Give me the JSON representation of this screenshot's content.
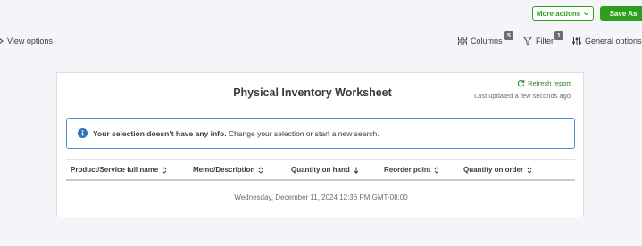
{
  "topbar": {
    "more_actions_label": "More actions",
    "save_as_label": "Save As"
  },
  "toolbar": {
    "view_options_label": "View options",
    "columns_label": "Columns",
    "columns_badge": "5",
    "filter_label": "Filter",
    "filter_badge": "1",
    "general_options_label": "General options"
  },
  "report": {
    "title": "Physical Inventory Worksheet",
    "refresh_label": "Refresh report",
    "last_updated": "Last updated a few seconds ago",
    "alert_bold": "Your selection doesn’t have any info.",
    "alert_text": " Change your selection or start a new search.",
    "columns": [
      {
        "label": "Product/Service full name",
        "sort": "both"
      },
      {
        "label": "Memo/Description",
        "sort": "both"
      },
      {
        "label": "Quantity on hand",
        "sort": "down"
      },
      {
        "label": "Reorder point",
        "sort": "both"
      },
      {
        "label": "Quantity on order",
        "sort": "both"
      }
    ],
    "footer_timestamp": "Wednesday, December 11, 2024 12:36 PM GMT-08:00"
  },
  "colors": {
    "brand_green": "#2ca01c",
    "info_blue": "#4f8fd6",
    "text": "#393a3d",
    "muted": "#6b6c72"
  }
}
